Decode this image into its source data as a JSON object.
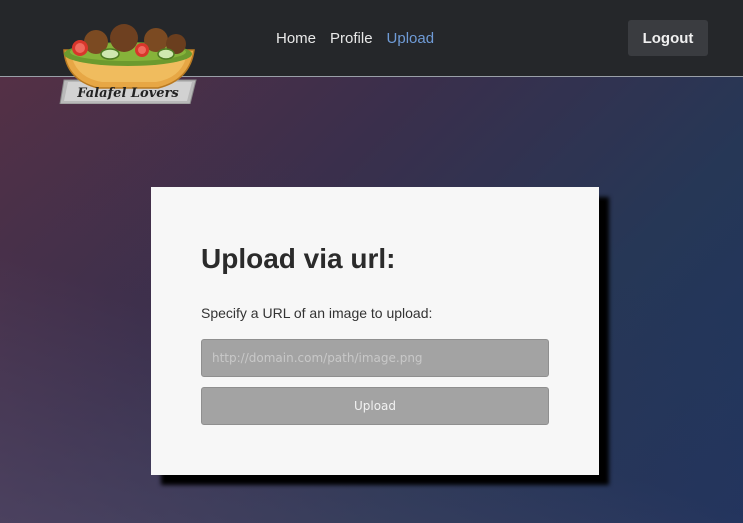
{
  "brand": {
    "logo_text": "Falafel Lovers"
  },
  "nav": {
    "items": [
      {
        "label": "Home"
      },
      {
        "label": "Profile"
      },
      {
        "label": "Upload"
      }
    ],
    "logout_label": "Logout"
  },
  "upload": {
    "title": "Upload via url:",
    "description": "Specify a URL of an image to upload:",
    "url_value": "",
    "url_placeholder": "http://domain.com/path/image.png",
    "button_label": "Upload"
  },
  "colors": {
    "navbar_bg": "#25272a",
    "active_link": "#6f9bd6",
    "card_bg": "#f7f7f7",
    "input_bg": "#a3a3a3"
  }
}
